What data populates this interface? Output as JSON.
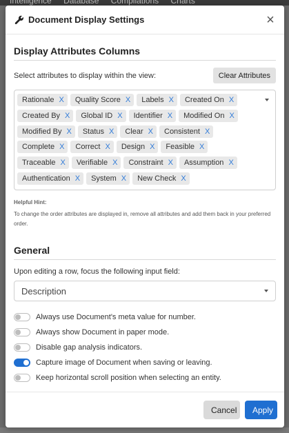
{
  "background": {
    "tabs": [
      "Intelligence",
      "Database",
      "Compilations",
      "Charts"
    ]
  },
  "dialog": {
    "title": "Document Display Settings",
    "close_label": "×"
  },
  "display_section": {
    "title": "Display Attributes Columns",
    "select_label": "Select attributes to display within the view:",
    "clear_label": "Clear Attributes",
    "remove_label": "X",
    "attributes": [
      "Rationale",
      "Quality Score",
      "Labels",
      "Created On",
      "Created By",
      "Global ID",
      "Identifier",
      "Modified On",
      "Modified By",
      "Status",
      "Clear",
      "Consistent",
      "Complete",
      "Correct",
      "Design",
      "Feasible",
      "Traceable",
      "Verifiable",
      "Constraint",
      "Assumption",
      "Authentication",
      "System",
      "New Check"
    ],
    "hint_title": "Helpful Hint:",
    "hint_text": "To change the order attributes are displayed in, remove all attributes and add them back in your preferred order."
  },
  "general_section": {
    "title": "General",
    "focus_label": "Upon editing a row, focus the following input field:",
    "focus_value": "Description",
    "options": [
      {
        "label": "Always use Document's meta value for number.",
        "checked": false
      },
      {
        "label": "Always show Document in paper mode.",
        "checked": false
      },
      {
        "label": "Disable gap analysis indicators.",
        "checked": false
      },
      {
        "label": "Capture image of Document when saving or leaving.",
        "checked": true
      },
      {
        "label": "Keep horizontal scroll position when selecting an entity.",
        "checked": false
      }
    ]
  },
  "footer": {
    "cancel_label": "Cancel",
    "apply_label": "Apply"
  },
  "colors": {
    "accent": "#1f6fd1",
    "tag_remove": "#2f7ad8"
  }
}
